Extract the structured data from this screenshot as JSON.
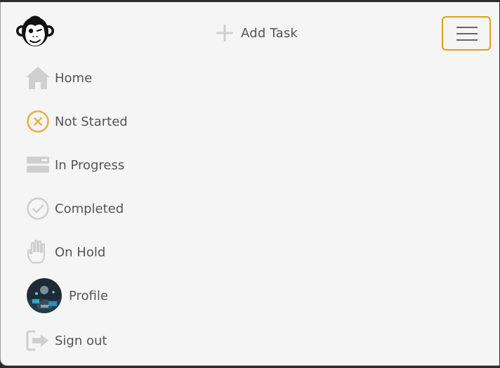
{
  "header": {
    "add_task_label": "Add Task"
  },
  "nav": {
    "items": [
      {
        "label": "Home",
        "icon": "home-icon"
      },
      {
        "label": "Not Started",
        "icon": "x-circle-icon"
      },
      {
        "label": "In Progress",
        "icon": "progress-icon"
      },
      {
        "label": "Completed",
        "icon": "check-circle-icon"
      },
      {
        "label": "On Hold",
        "icon": "hand-icon"
      },
      {
        "label": "Profile",
        "icon": "avatar"
      },
      {
        "label": "Sign out",
        "icon": "sign-out-icon"
      }
    ]
  },
  "colors": {
    "accent": "#dda21c",
    "not_started_icon": "#e8b04a",
    "icon_gray": "#cfcfcf",
    "text": "#555555",
    "background": "#f5f5f5"
  }
}
